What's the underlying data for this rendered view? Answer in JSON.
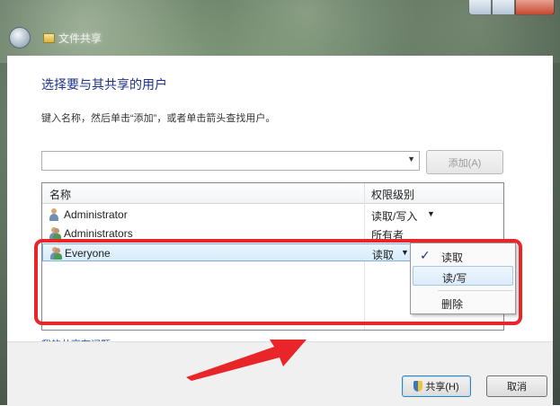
{
  "window": {
    "title": "文件共享"
  },
  "dialog": {
    "heading": "选择要与其共享的用户",
    "instruction": "键入名称，然后单击“添加”，或者单击箭头查找用户。",
    "combo_value": "",
    "add_button": "添加(A)",
    "help_link": "我的共享有问题",
    "share_button": "共享(H)",
    "cancel_button": "取消"
  },
  "table": {
    "headers": {
      "name": "名称",
      "permission": "权限级别"
    },
    "rows": [
      {
        "name": "Administrator",
        "permission": "读取/写入",
        "icon": "user-icon"
      },
      {
        "name": "Administrators",
        "permission": "所有者",
        "icon": "group-icon"
      },
      {
        "name": "Everyone",
        "permission": "读取",
        "icon": "group-icon",
        "selected": true
      }
    ]
  },
  "permission_menu": {
    "items": [
      {
        "label": "读取",
        "checked": true
      },
      {
        "label": "读/写",
        "hovered": true
      },
      {
        "label": "删除"
      }
    ]
  },
  "annotation": {
    "highlight_color": "#e8262a"
  }
}
